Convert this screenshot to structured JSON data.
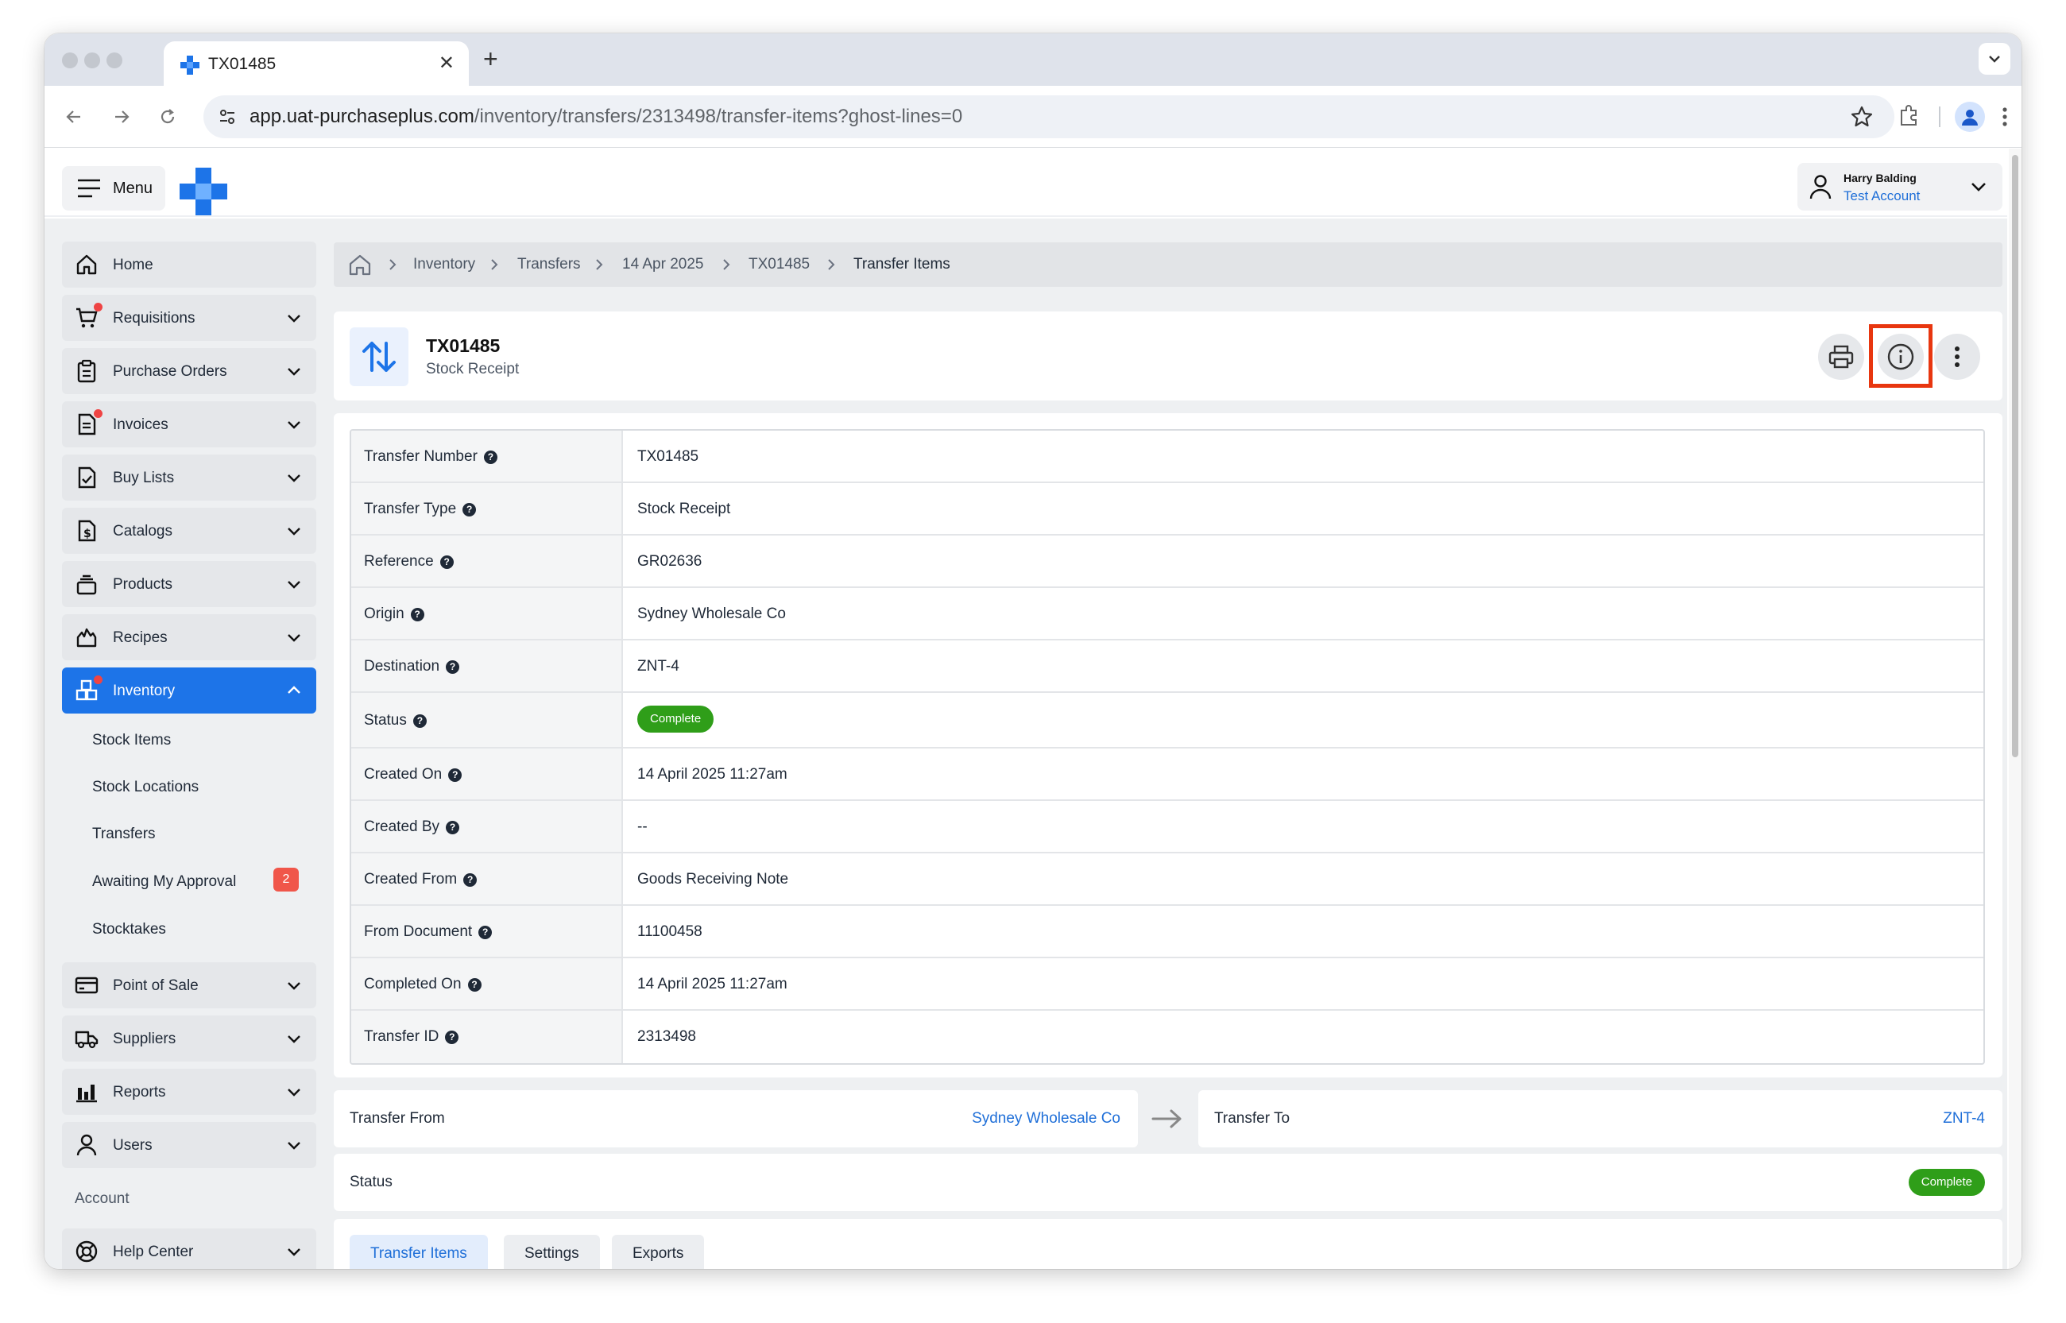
{
  "browser": {
    "tab_title": "TX01485",
    "url_host": "app.uat-purchaseplus.com",
    "url_path": "/inventory/transfers/2313498/transfer-items?ghost-lines=0"
  },
  "header": {
    "menu_label": "Menu",
    "user_name": "Harry Balding",
    "user_account": "Test Account"
  },
  "sidebar": {
    "items": [
      {
        "label": "Home",
        "icon": "home-icon"
      },
      {
        "label": "Requisitions",
        "icon": "cart-icon"
      },
      {
        "label": "Purchase Orders",
        "icon": "clipboard-icon"
      },
      {
        "label": "Invoices",
        "icon": "invoice-icon"
      },
      {
        "label": "Buy Lists",
        "icon": "checklist-icon"
      },
      {
        "label": "Catalogs",
        "icon": "dollar-doc-icon"
      },
      {
        "label": "Products",
        "icon": "layers-icon"
      },
      {
        "label": "Recipes",
        "icon": "fire-icon"
      },
      {
        "label": "Inventory",
        "icon": "boxes-icon"
      }
    ],
    "inventory_sub": [
      "Stock Items",
      "Stock Locations",
      "Transfers",
      "Awaiting My Approval",
      "Stocktakes"
    ],
    "awaiting_count": "2",
    "items_after": [
      {
        "label": "Point of Sale",
        "icon": "card-icon"
      },
      {
        "label": "Suppliers",
        "icon": "truck-icon"
      },
      {
        "label": "Reports",
        "icon": "bar-chart-icon"
      },
      {
        "label": "Users",
        "icon": "user-icon"
      }
    ],
    "account_section": "Account",
    "help_center": "Help Center"
  },
  "breadcrumb": [
    "Inventory",
    "Transfers",
    "14 Apr 2025",
    "TX01485",
    "Transfer Items"
  ],
  "transfer": {
    "title": "TX01485",
    "subtitle": "Stock Receipt"
  },
  "details": [
    {
      "label": "Transfer Number",
      "value": "TX01485"
    },
    {
      "label": "Transfer Type",
      "value": "Stock Receipt"
    },
    {
      "label": "Reference",
      "value": "GR02636"
    },
    {
      "label": "Origin",
      "value": "Sydney Wholesale Co"
    },
    {
      "label": "Destination",
      "value": "ZNT-4"
    },
    {
      "label": "Status",
      "value": "Complete"
    },
    {
      "label": "Created On",
      "value": "14 April 2025 11:27am"
    },
    {
      "label": "Created By",
      "value": "--"
    },
    {
      "label": "Created From",
      "value": "Goods Receiving Note"
    },
    {
      "label": "From Document",
      "value": "11100458"
    },
    {
      "label": "Completed On",
      "value": "14 April 2025 11:27am"
    },
    {
      "label": "Transfer ID",
      "value": "2313498"
    }
  ],
  "transfer_from": {
    "label": "Transfer From",
    "value": "Sydney Wholesale Co"
  },
  "transfer_to": {
    "label": "Transfer To",
    "value": "ZNT-4"
  },
  "status_row": {
    "label": "Status",
    "value": "Complete"
  },
  "tabs": [
    "Transfer Items",
    "Settings",
    "Exports"
  ],
  "colors": {
    "accent": "#1d74e8",
    "success": "#2f9e19",
    "highlight": "#e8360f",
    "badge": "#f0564a"
  }
}
